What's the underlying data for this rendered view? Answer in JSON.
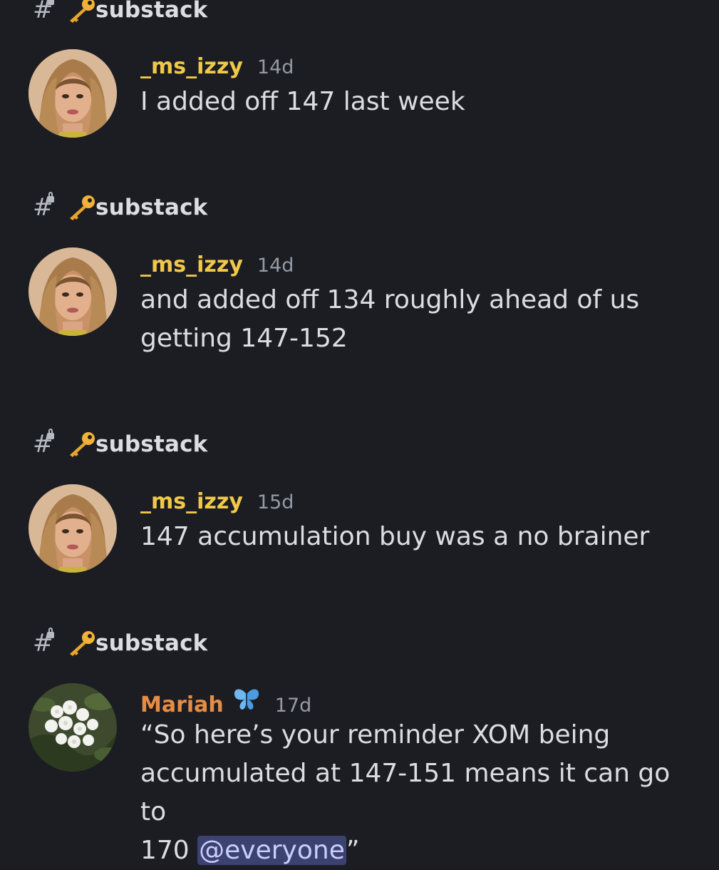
{
  "channel": {
    "name": "substack",
    "icon": "locked-hash-icon",
    "emoji": "key-icon"
  },
  "colors": {
    "background": "#1c1d22",
    "ms_izzy_name": "#f0c949",
    "mariah_name": "#e58c45",
    "timestamp": "#949ba4",
    "text": "#dbdee1",
    "mention_bg": "#3c4270"
  },
  "results": [
    {
      "channel": "substack",
      "author": "_ms_izzy",
      "timestamp": "14d",
      "text": "I added off 147 last week"
    },
    {
      "channel": "substack",
      "author": "_ms_izzy",
      "timestamp": "14d",
      "text_line1": "and added off 134 roughly ahead of us",
      "text_line2": "getting 147-152"
    },
    {
      "channel": "substack",
      "author": "_ms_izzy",
      "timestamp": "15d",
      "text": "147 accumulation buy was a no brainer"
    },
    {
      "channel": "substack",
      "author": "Mariah",
      "author_badge": "butterfly-icon",
      "timestamp": "17d",
      "text_line1": "“So here’s your reminder XOM being",
      "text_line2": "accumulated at 147-151 means it can go to",
      "text_line3_prefix": "170 ",
      "mention": "@everyone",
      "text_line3_suffix": "”"
    }
  ]
}
